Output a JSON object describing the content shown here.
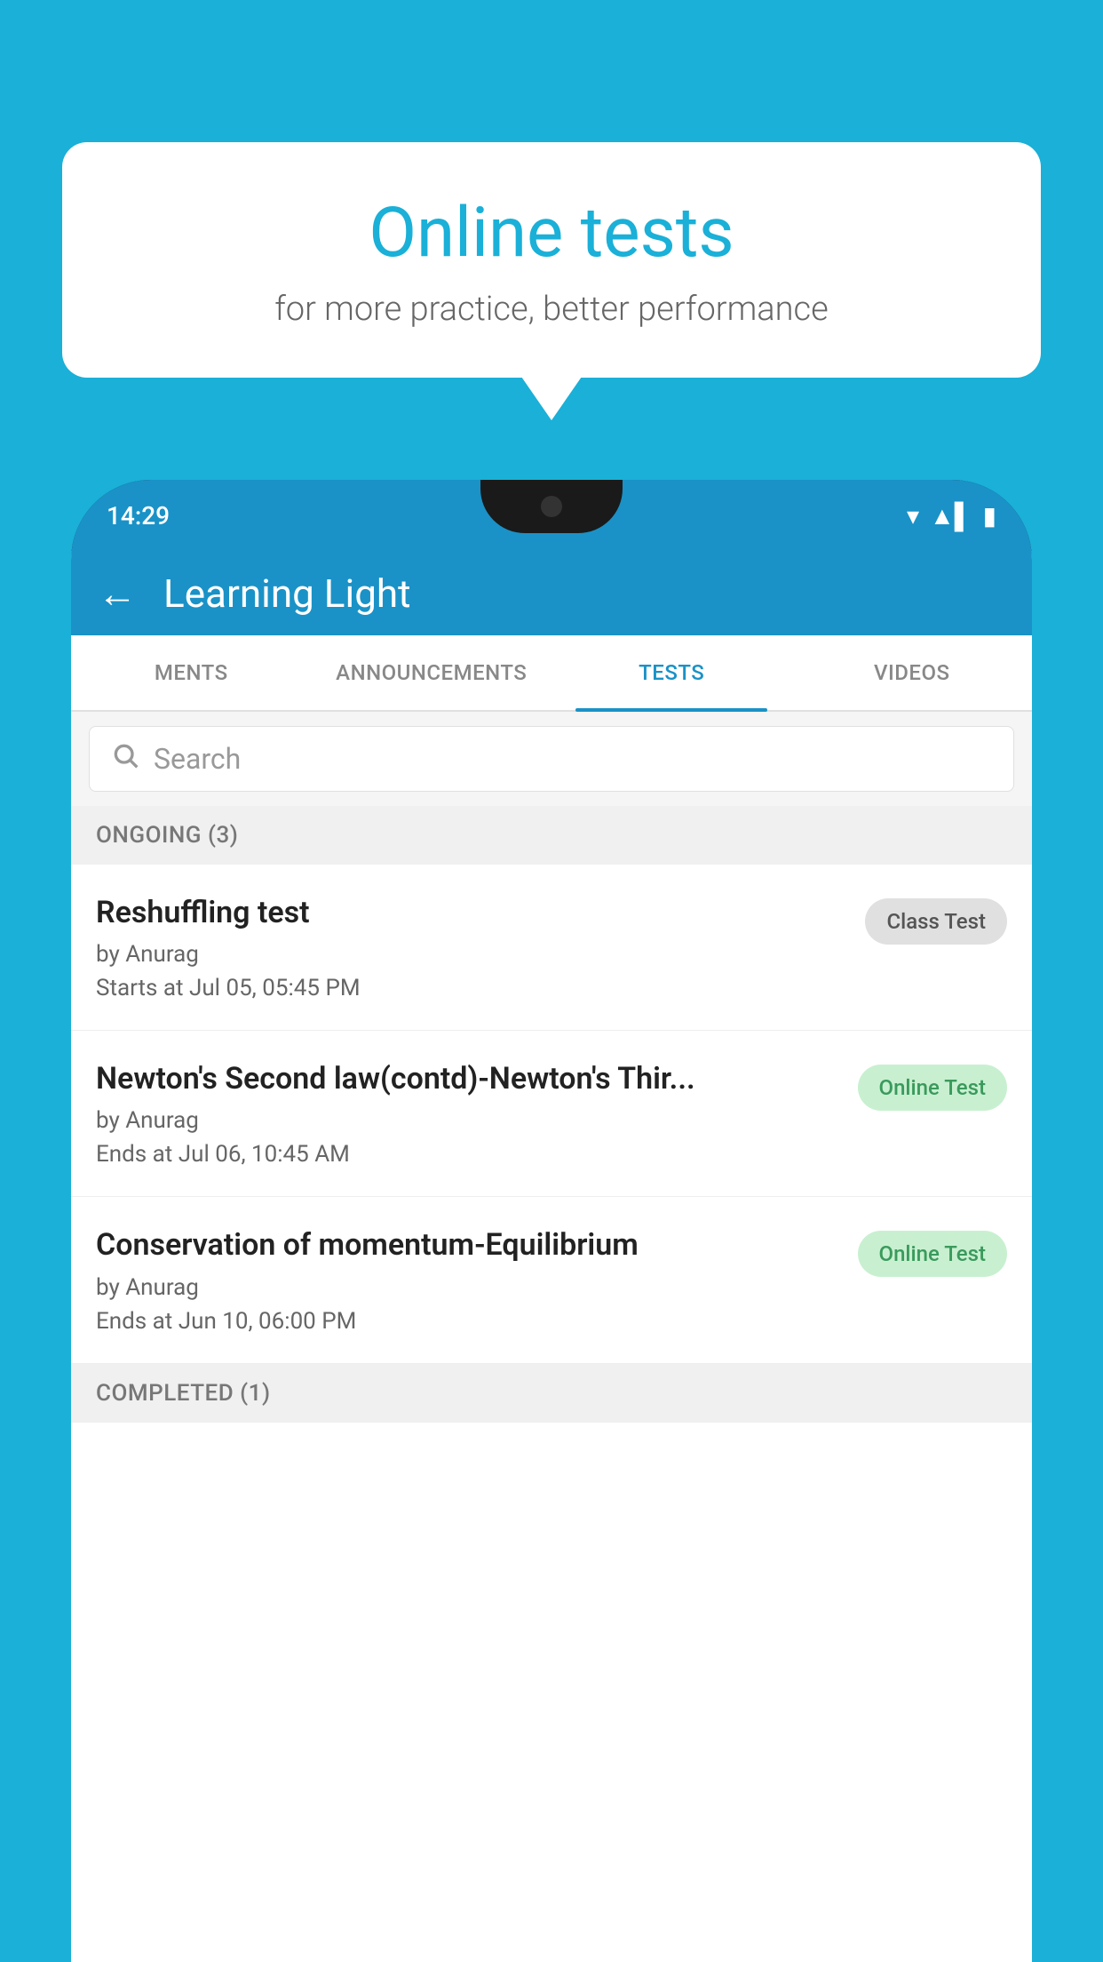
{
  "background": {
    "color": "#1ab0d8"
  },
  "speech_bubble": {
    "title": "Online tests",
    "subtitle": "for more practice, better performance"
  },
  "phone": {
    "status_bar": {
      "time": "14:29",
      "icons": [
        "▾",
        "▲▌",
        "▮"
      ]
    },
    "app_header": {
      "back_label": "←",
      "title": "Learning Light"
    },
    "tabs": [
      {
        "label": "MENTS",
        "active": false
      },
      {
        "label": "ANNOUNCEMENTS",
        "active": false
      },
      {
        "label": "TESTS",
        "active": true
      },
      {
        "label": "VIDEOS",
        "active": false
      }
    ],
    "search": {
      "placeholder": "Search"
    },
    "sections": [
      {
        "header": "ONGOING (3)",
        "tests": [
          {
            "name": "Reshuffling test",
            "author": "by Anurag",
            "date": "Starts at  Jul 05, 05:45 PM",
            "badge": "Class Test",
            "badge_type": "class"
          },
          {
            "name": "Newton's Second law(contd)-Newton's Thir...",
            "author": "by Anurag",
            "date": "Ends at  Jul 06, 10:45 AM",
            "badge": "Online Test",
            "badge_type": "online"
          },
          {
            "name": "Conservation of momentum-Equilibrium",
            "author": "by Anurag",
            "date": "Ends at  Jun 10, 06:00 PM",
            "badge": "Online Test",
            "badge_type": "online"
          }
        ]
      },
      {
        "header": "COMPLETED (1)",
        "tests": []
      }
    ]
  }
}
